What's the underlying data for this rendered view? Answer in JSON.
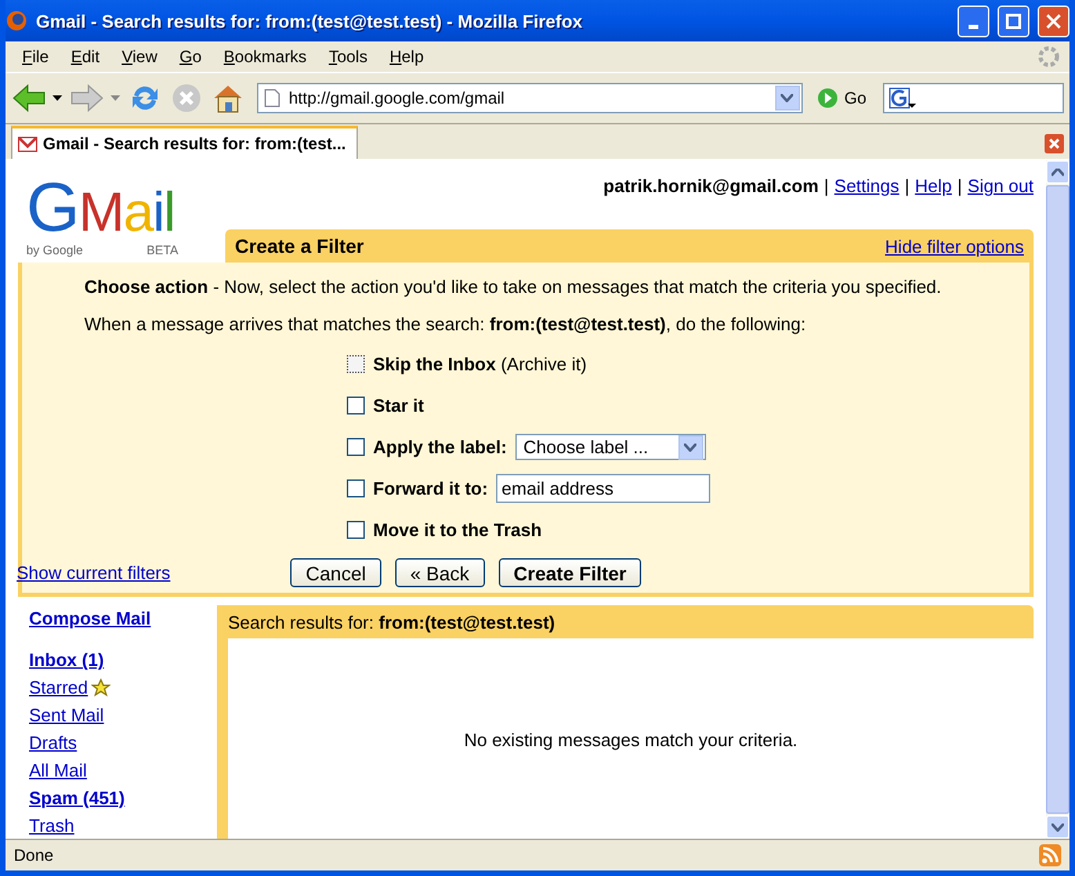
{
  "window": {
    "title": "Gmail - Search results for: from:(test@test.test) - Mozilla Firefox"
  },
  "menu": [
    {
      "key": "F",
      "rest": "ile"
    },
    {
      "key": "E",
      "rest": "dit"
    },
    {
      "key": "V",
      "rest": "iew"
    },
    {
      "key": "G",
      "rest": "o"
    },
    {
      "key": "B",
      "rest": "ookmarks"
    },
    {
      "key": "T",
      "rest": "ools"
    },
    {
      "key": "H",
      "rest": "elp"
    }
  ],
  "toolbar": {
    "url": "http://gmail.google.com/gmail",
    "go": "Go"
  },
  "tabs": [
    {
      "label": "Gmail - Search results for: from:(test...",
      "selected": true
    }
  ],
  "account": {
    "email": "patrik.hornik@gmail.com",
    "separator": "|",
    "links": [
      "Settings",
      "Help",
      "Sign out"
    ]
  },
  "logo": {
    "letters": [
      "G",
      "M",
      "a",
      "i",
      "l"
    ],
    "byline": "by Google",
    "badge": "BETA"
  },
  "filter": {
    "title": "Create a Filter",
    "hide_link": "Hide filter options",
    "intro": "**Choose action** - Now, select the action you'd like to take on messages that match the criteria you specified.",
    "search_line": "When a message arrives that matches the search: **from:(test@test.test)**, do the following:",
    "actions": [
      {
        "kind": "plain",
        "label": "Skip the Inbox",
        "note": "(Archive it)",
        "checked": false,
        "focused": true
      },
      {
        "kind": "plain",
        "label": "Star it",
        "checked": false,
        "focused": false
      },
      {
        "kind": "select",
        "label": "Apply the label:",
        "value": "Choose label ...",
        "checked": false,
        "focused": false
      },
      {
        "kind": "input",
        "label": "Forward it to:",
        "value": "email address",
        "checked": false,
        "focused": false
      },
      {
        "kind": "plain",
        "label": "Move it to the Trash",
        "checked": false,
        "focused": false
      }
    ],
    "show_link": "Show current filters",
    "buttons": [
      {
        "label": "Cancel",
        "primary": false
      },
      {
        "label": "« Back",
        "primary": false
      },
      {
        "label": "Create Filter",
        "primary": true
      }
    ]
  },
  "sidebar": {
    "compose": "Compose Mail",
    "items": [
      {
        "kind": "folder",
        "label": "Inbox (1)",
        "unread": true
      },
      {
        "kind": "starred",
        "label": "Starred",
        "unread": false
      },
      {
        "kind": "folder",
        "label": "Sent Mail",
        "unread": false
      },
      {
        "kind": "folder",
        "label": "Drafts",
        "unread": false
      },
      {
        "kind": "folder",
        "label": "All Mail",
        "unread": false
      },
      {
        "kind": "folder",
        "label": "Spam (451)",
        "unread": true
      },
      {
        "kind": "folder",
        "label": "Trash",
        "unread": false
      }
    ]
  },
  "results": {
    "header": "Search results for: **from:(test@test.test)**",
    "empty": "No existing messages match your criteria."
  },
  "status_bar": {
    "text": "Done"
  }
}
